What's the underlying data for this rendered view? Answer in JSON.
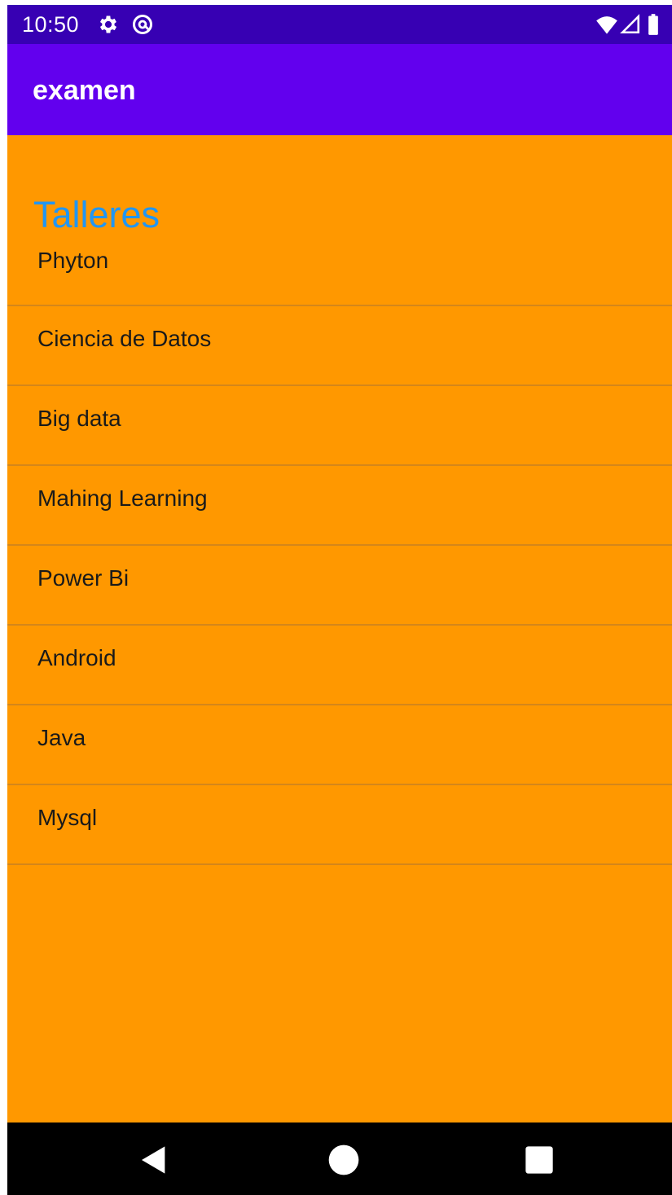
{
  "status_bar": {
    "time": "10:50",
    "icons_left": [
      "settings-icon",
      "at-sign-icon"
    ],
    "icons_right": [
      "wifi-icon",
      "cellular-signal-icon",
      "battery-icon"
    ]
  },
  "app_bar": {
    "title": "examen",
    "color": "#6200ee"
  },
  "content": {
    "background": "#ff9800",
    "section_title": "Talleres",
    "items": [
      {
        "label": "Phyton"
      },
      {
        "label": "Ciencia de Datos"
      },
      {
        "label": "Big data"
      },
      {
        "label": "Mahing Learning"
      },
      {
        "label": "Power Bi"
      },
      {
        "label": "Android"
      },
      {
        "label": "Java"
      },
      {
        "label": "Mysql"
      }
    ]
  },
  "nav_bar": {
    "buttons": [
      "back-icon",
      "home-icon",
      "recents-icon"
    ]
  }
}
